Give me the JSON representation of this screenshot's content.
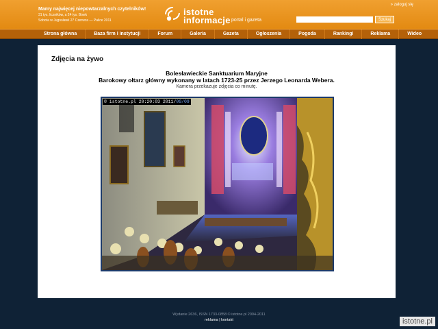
{
  "header": {
    "tagline_title": "Mamy najwięcej niepowtarzalnych czytelników!",
    "tagline_line2": "31 tys. liczników, a 24 tys. Bisek",
    "tagline_line3": "Sobota w Jugosławii 27 Czerwca — Palice 2011",
    "logo_line1": "istotne",
    "logo_line2": "informacje",
    "logo_sub": "portal i gazeta",
    "login_label": "» zaloguj się",
    "search_placeholder": "",
    "search_button": "Szukaj"
  },
  "nav": {
    "items": [
      "Strona główna",
      "Baza firm i instytucji",
      "Forum",
      "Galeria",
      "Gazeta",
      "Ogłoszenia",
      "Pogoda",
      "Rankingi",
      "Reklama",
      "Wideo"
    ]
  },
  "main": {
    "page_title": "Zdjęcia na żywo",
    "headline1": "Bolesławieckie Sanktuarium Maryjne",
    "headline2": "Barokowy ołtarz główny wykonany w latach 1723-25 przez Jerzego Leonarda Webera.",
    "caption": "Kamera przekazuje zdjęcia co minutę.",
    "camera_stamp_prefix": "© istotne.pl 20:20:03 2011/",
    "camera_stamp_date": "09/09"
  },
  "footer": {
    "text": "Wydanie 2636, ISSN 1733-0858 © istotne.pl 2004-2011",
    "link_ad": "reklama",
    "separator": "|",
    "link_contact": "kontakt"
  },
  "watermark": "istotne.pl",
  "colors": {
    "header_orange": "#e99520",
    "nav_brown": "#b46109",
    "background_navy": "#0f2236"
  }
}
